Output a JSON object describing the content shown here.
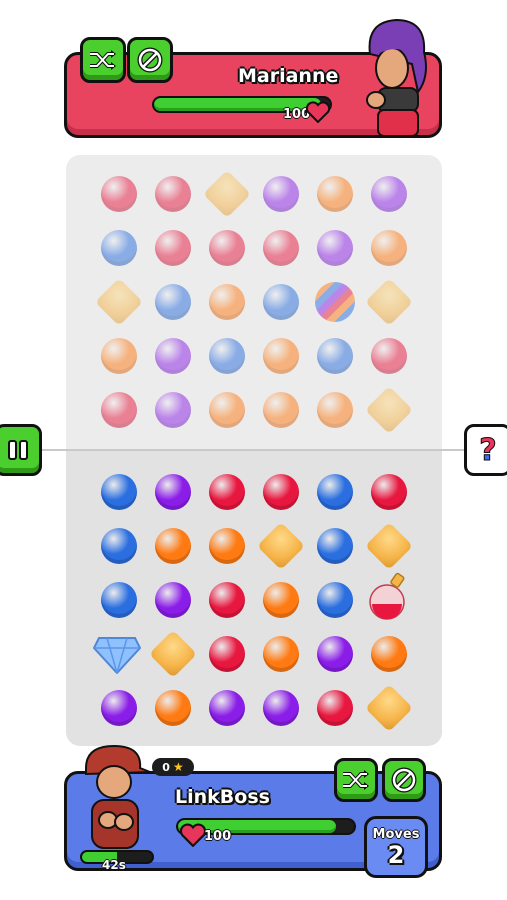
{
  "opponent": {
    "name": "Marianne",
    "hp": 100,
    "hp_fraction": 0.95,
    "shuffle_icon": "shuffle-icon",
    "block_icon": "no-entry-icon"
  },
  "player": {
    "name": "LinkBoss",
    "hp": 100,
    "hp_fraction": 0.9,
    "stars": "0",
    "timer": "42s",
    "timer_fraction": 0.5,
    "moves_label": "Moves",
    "moves": "2"
  },
  "side": {
    "pause_icon": "pause-icon",
    "help_glyph": "?"
  },
  "colors": {
    "red": "#e8173f",
    "orange": "#ff7a12",
    "blue": "#2a6ee0",
    "purple": "#8a1ee8",
    "gold": "#f6b54a",
    "green": "#4bcf2e",
    "opponent_panel": "#e8445f",
    "player_panel": "#5b7be8"
  },
  "board": {
    "opponent_grid": [
      [
        "red",
        "red",
        "gold",
        "purple",
        "orange",
        "purple"
      ],
      [
        "blue",
        "red",
        "red",
        "red",
        "purple",
        "orange"
      ],
      [
        "gold",
        "blue",
        "orange",
        "blue",
        "striped",
        "gold"
      ],
      [
        "orange",
        "purple",
        "blue",
        "orange",
        "blue",
        "red"
      ],
      [
        "red",
        "purple",
        "orange",
        "orange",
        "orange",
        "gold"
      ]
    ],
    "player_grid": [
      [
        "blue",
        "purple",
        "red",
        "red",
        "blue",
        "red"
      ],
      [
        "blue",
        "orange",
        "orange",
        "gold",
        "blue",
        "gold"
      ],
      [
        "blue",
        "purple",
        "red",
        "orange",
        "blue",
        "potion"
      ],
      [
        "crystal",
        "gold",
        "red",
        "orange",
        "purple",
        "orange"
      ],
      [
        "purple",
        "orange",
        "purple",
        "purple",
        "red",
        "gold"
      ]
    ]
  }
}
